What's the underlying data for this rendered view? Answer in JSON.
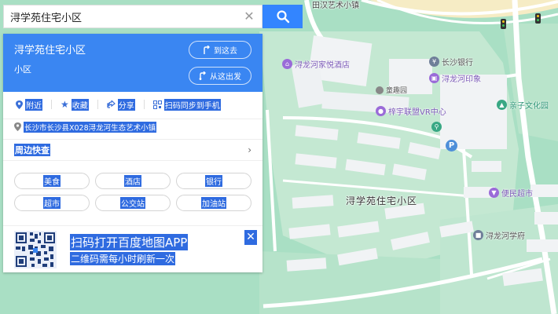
{
  "search": {
    "value": "浔学苑住宅小区",
    "clear_icon": "close-icon",
    "search_icon": "search-icon",
    "button_color": "#3385ff"
  },
  "panel": {
    "name": "浔学苑住宅小区",
    "type": "小区",
    "goto_label": "到这去",
    "from_label": "从这出发",
    "head_color": "#3a86f2",
    "actions": [
      {
        "label": "附近",
        "icon": "location-pin-icon"
      },
      {
        "label": "收藏",
        "icon": "star-icon"
      },
      {
        "label": "分享",
        "icon": "share-icon"
      },
      {
        "label": "扫码同步到手机",
        "icon": "qr-scan-icon"
      }
    ],
    "address": "长沙市长沙县X028浔龙河生态艺术小镇",
    "nearby_title": "周边快查",
    "categories": [
      "美食",
      "酒店",
      "银行",
      "超市",
      "公交站",
      "加油站"
    ],
    "qr_title": "扫码打开百度地图APP",
    "qr_subtitle": "二维码需每小时刷新一次"
  },
  "map": {
    "top_label": "田汉艺术小镇",
    "area_label": "浔学苑住宅小区",
    "pois": [
      {
        "name": "浔龙河家悦酒店",
        "icon": "hotel-icon",
        "color": "#9a6bd8"
      },
      {
        "name": "长沙银行",
        "icon": "bank-icon",
        "color": "#6f7f99"
      },
      {
        "name": "浔龙河印象",
        "icon": "landmark-icon",
        "color": "#9a6bd8"
      },
      {
        "name": "童趣园",
        "icon": "building-icon",
        "color": "#888888"
      },
      {
        "name": "梓宇联盟VR中心",
        "icon": "game-icon",
        "color": "#9a6bd8"
      },
      {
        "name": "亲子文化园",
        "icon": "park-icon",
        "color": "#39a884"
      },
      {
        "name": "便民超市",
        "icon": "shopping-cart-icon",
        "color": "#9a6bd8"
      },
      {
        "name": "浔龙河学府",
        "icon": "school-icon",
        "color": "#6f7f99"
      }
    ],
    "parking_label": "P"
  }
}
